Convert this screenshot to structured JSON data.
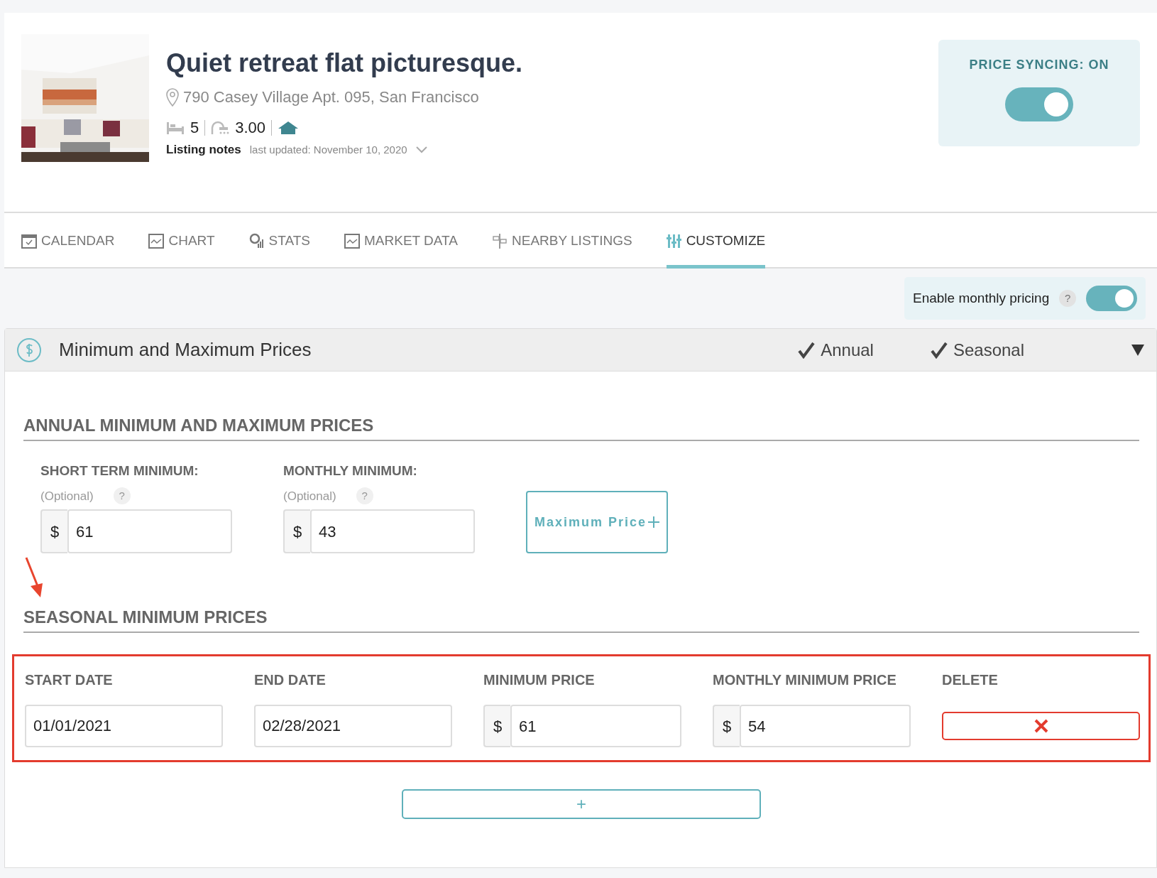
{
  "listing": {
    "title": "Quiet retreat flat picturesque.",
    "address": "790 Casey Village Apt. 095, San Francisco",
    "beds": "5",
    "baths": "3.00",
    "notes_label": "Listing notes",
    "notes_updated": "last updated: November 10, 2020"
  },
  "price_sync": {
    "label": "PRICE SYNCING: ON",
    "on": true
  },
  "tabs": [
    {
      "label": "CALENDAR",
      "selected": false
    },
    {
      "label": "CHART",
      "selected": false
    },
    {
      "label": "STATS",
      "selected": false
    },
    {
      "label": "MARKET DATA",
      "selected": false
    },
    {
      "label": "NEARBY LISTINGS",
      "selected": false
    },
    {
      "label": "CUSTOMIZE",
      "selected": true
    }
  ],
  "monthly_pricing": {
    "label": "Enable monthly pricing",
    "help": "?",
    "on": true
  },
  "section": {
    "title": "Minimum and Maximum Prices",
    "expanded": true,
    "filters": [
      {
        "label": "Annual",
        "checked": true
      },
      {
        "label": "Seasonal",
        "checked": true
      }
    ]
  },
  "annual": {
    "heading": "ANNUAL MINIMUM AND MAXIMUM PRICES",
    "fields": [
      {
        "label": "SHORT TERM MINIMUM:",
        "hint": "(Optional)",
        "help": "?",
        "prefix": "$",
        "value": "61"
      },
      {
        "label": "MONTHLY MINIMUM:",
        "hint": "(Optional)",
        "help": "?",
        "prefix": "$",
        "value": "43"
      }
    ],
    "button": "Maximum Price"
  },
  "seasonal": {
    "heading": "SEASONAL MINIMUM PRICES",
    "columns": [
      "START DATE",
      "END DATE",
      "MINIMUM PRICE",
      "MONTHLY MINIMUM PRICE",
      "DELETE"
    ],
    "rows": [
      {
        "start": "01/01/2021",
        "end": "02/28/2021",
        "min_prefix": "$",
        "min": "61",
        "monthly_prefix": "$",
        "monthly": "54"
      }
    ],
    "add_button": "+"
  }
}
